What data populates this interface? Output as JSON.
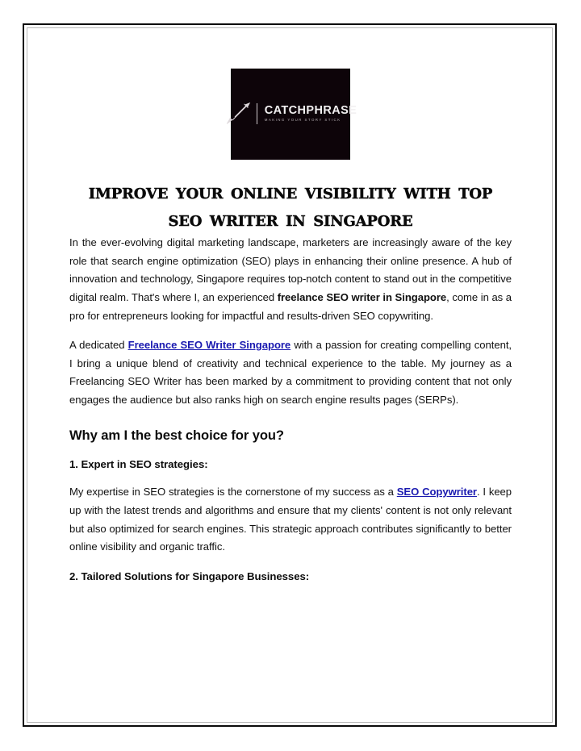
{
  "document": {
    "logo": {
      "name": "CATCHPHRASE",
      "tagline": "MAKING YOUR STORY STICK",
      "icon": "pencil-icon",
      "background_color": "#0d0409",
      "text_color": "#f2f0f1"
    },
    "title": "Improve Your Online Visibility With Top SEO Writer In Singapore",
    "paragraphs": [
      {
        "id": "intro",
        "runs": [
          {
            "type": "text",
            "text": "In the ever-evolving digital marketing landscape, marketers are increasingly aware of the key role that search engine optimization (SEO) plays in enhancing their online presence. A hub of innovation and technology, Singapore requires top-notch content to stand out in the competitive digital realm. That's where I, an experienced "
          },
          {
            "type": "bold",
            "text": "freelance SEO writer in Singapore"
          },
          {
            "type": "text",
            "text": ", come in as a pro for entrepreneurs looking for impactful and results-driven SEO copywriting."
          }
        ]
      },
      {
        "id": "dedicated",
        "runs": [
          {
            "type": "text",
            "text": "A dedicated "
          },
          {
            "type": "link",
            "text": "Freelance SEO Writer Singapore"
          },
          {
            "type": "text",
            "text": " with a passion for creating compelling content, I bring a unique blend of creativity and technical experience to the table. My journey as a Freelancing SEO Writer has been marked by a commitment to providing content that not only engages the audience but also ranks high on search engine results pages (SERPs)."
          }
        ]
      }
    ],
    "section_heading": "Why am I the best choice for you?",
    "sub_heading_1": "1. Expert in SEO strategies:",
    "expertise_paragraph": {
      "id": "expertise",
      "runs": [
        {
          "type": "text",
          "text": "My expertise in SEO strategies is the cornerstone of my success as a "
        },
        {
          "type": "link",
          "text": "SEO Copywriter"
        },
        {
          "type": "text",
          "text": ". I keep up with the latest trends and algorithms and ensure that my clients' content is not only relevant but also optimized for search engines. This strategic approach contributes significantly to better online visibility and organic traffic."
        }
      ]
    },
    "sub_heading_2": "2. Tailored Solutions for Singapore Businesses:",
    "colors": {
      "link": "#1a1ab0",
      "text": "#111111",
      "border_outer": "#0b0b0b",
      "border_inner": "#b9b9b9"
    }
  }
}
